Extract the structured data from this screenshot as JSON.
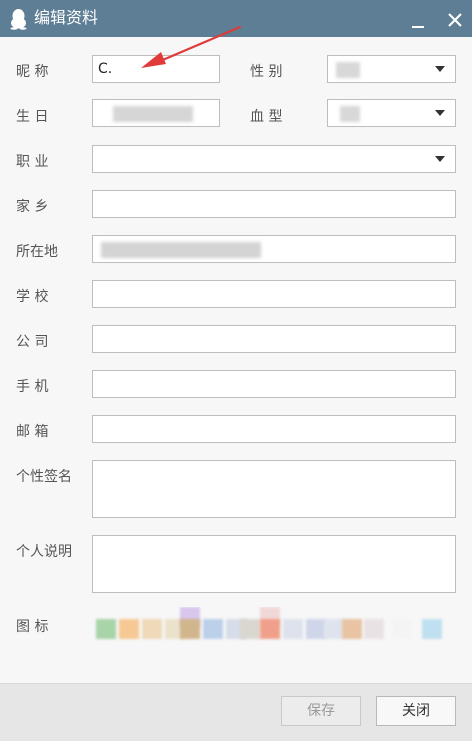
{
  "window": {
    "title": "编辑资料"
  },
  "fields": {
    "nickname_label": "昵 称",
    "nickname_value": "C.",
    "gender_label": "性 别",
    "birthday_label": "生 日",
    "blood_label": "血 型",
    "job_label": "职 业",
    "hometown_label": "家 乡",
    "location_label": "所在地",
    "school_label": "学 校",
    "company_label": "公 司",
    "phone_label": "手 机",
    "email_label": "邮 箱",
    "signature_label": "个性签名",
    "description_label": "个人说明",
    "icon_label": "图 标"
  },
  "buttons": {
    "save": "保存",
    "close": "关闭"
  },
  "colors": {
    "titlebar": "#5e7e95",
    "annotation_arrow": "#e03a3a"
  },
  "icons": {
    "app_icon": "qq-penguin-icon",
    "minimize": "minimize-icon",
    "close": "close-icon",
    "dropdown": "chevron-down-icon"
  }
}
